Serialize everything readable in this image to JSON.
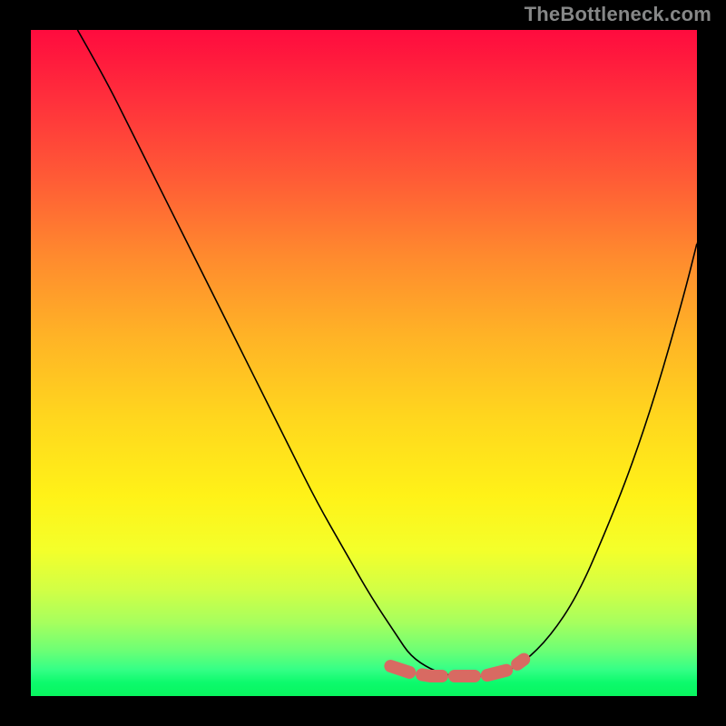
{
  "attribution": "TheBottleneck.com",
  "colors": {
    "gradient_top": "#ff0b3e",
    "gradient_bottom": "#09f55f",
    "curve": "#000000",
    "dash": "#d86a62",
    "frame": "#000000",
    "attribution_text": "#868787"
  },
  "chart_data": {
    "type": "line",
    "title": "",
    "xlabel": "",
    "ylabel": "",
    "xlim": [
      0,
      100
    ],
    "ylim": [
      0,
      100
    ],
    "grid": false,
    "legend": false,
    "series": [
      {
        "name": "bottleneck-curve",
        "x": [
          7,
          11,
          15,
          19,
          23,
          27,
          31,
          35,
          39,
          43,
          47,
          51,
          55,
          57,
          60,
          63,
          66,
          70,
          74,
          78,
          82,
          86,
          90,
          94,
          98,
          100
        ],
        "y": [
          100,
          93,
          85,
          77,
          69,
          61,
          53,
          45,
          37,
          29,
          22,
          15,
          9,
          6,
          4,
          3,
          3,
          3,
          5,
          9,
          15,
          24,
          34,
          46,
          60,
          68
        ]
      }
    ],
    "annotations": [
      {
        "name": "dashed-bottom-marker",
        "type": "dashed_polyline",
        "points_x": [
          54,
          57,
          60,
          64,
          68,
          72,
          74
        ],
        "points_y": [
          4.5,
          3.5,
          3,
          3,
          3,
          4,
          5.5
        ]
      }
    ]
  }
}
